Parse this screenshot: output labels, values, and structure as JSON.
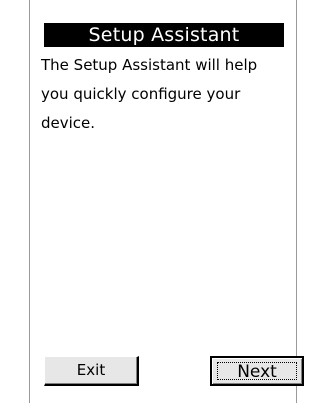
{
  "dialog": {
    "title": "Setup Assistant",
    "message_lines": [
      "The Setup Assistant will help",
      "you quickly configure your",
      "device."
    ]
  },
  "buttons": {
    "exit_label": "Exit",
    "next_label": "Next"
  },
  "colors": {
    "title_background": "#000000",
    "title_text": "#ffffff",
    "button_face": "#e7e7e7"
  }
}
